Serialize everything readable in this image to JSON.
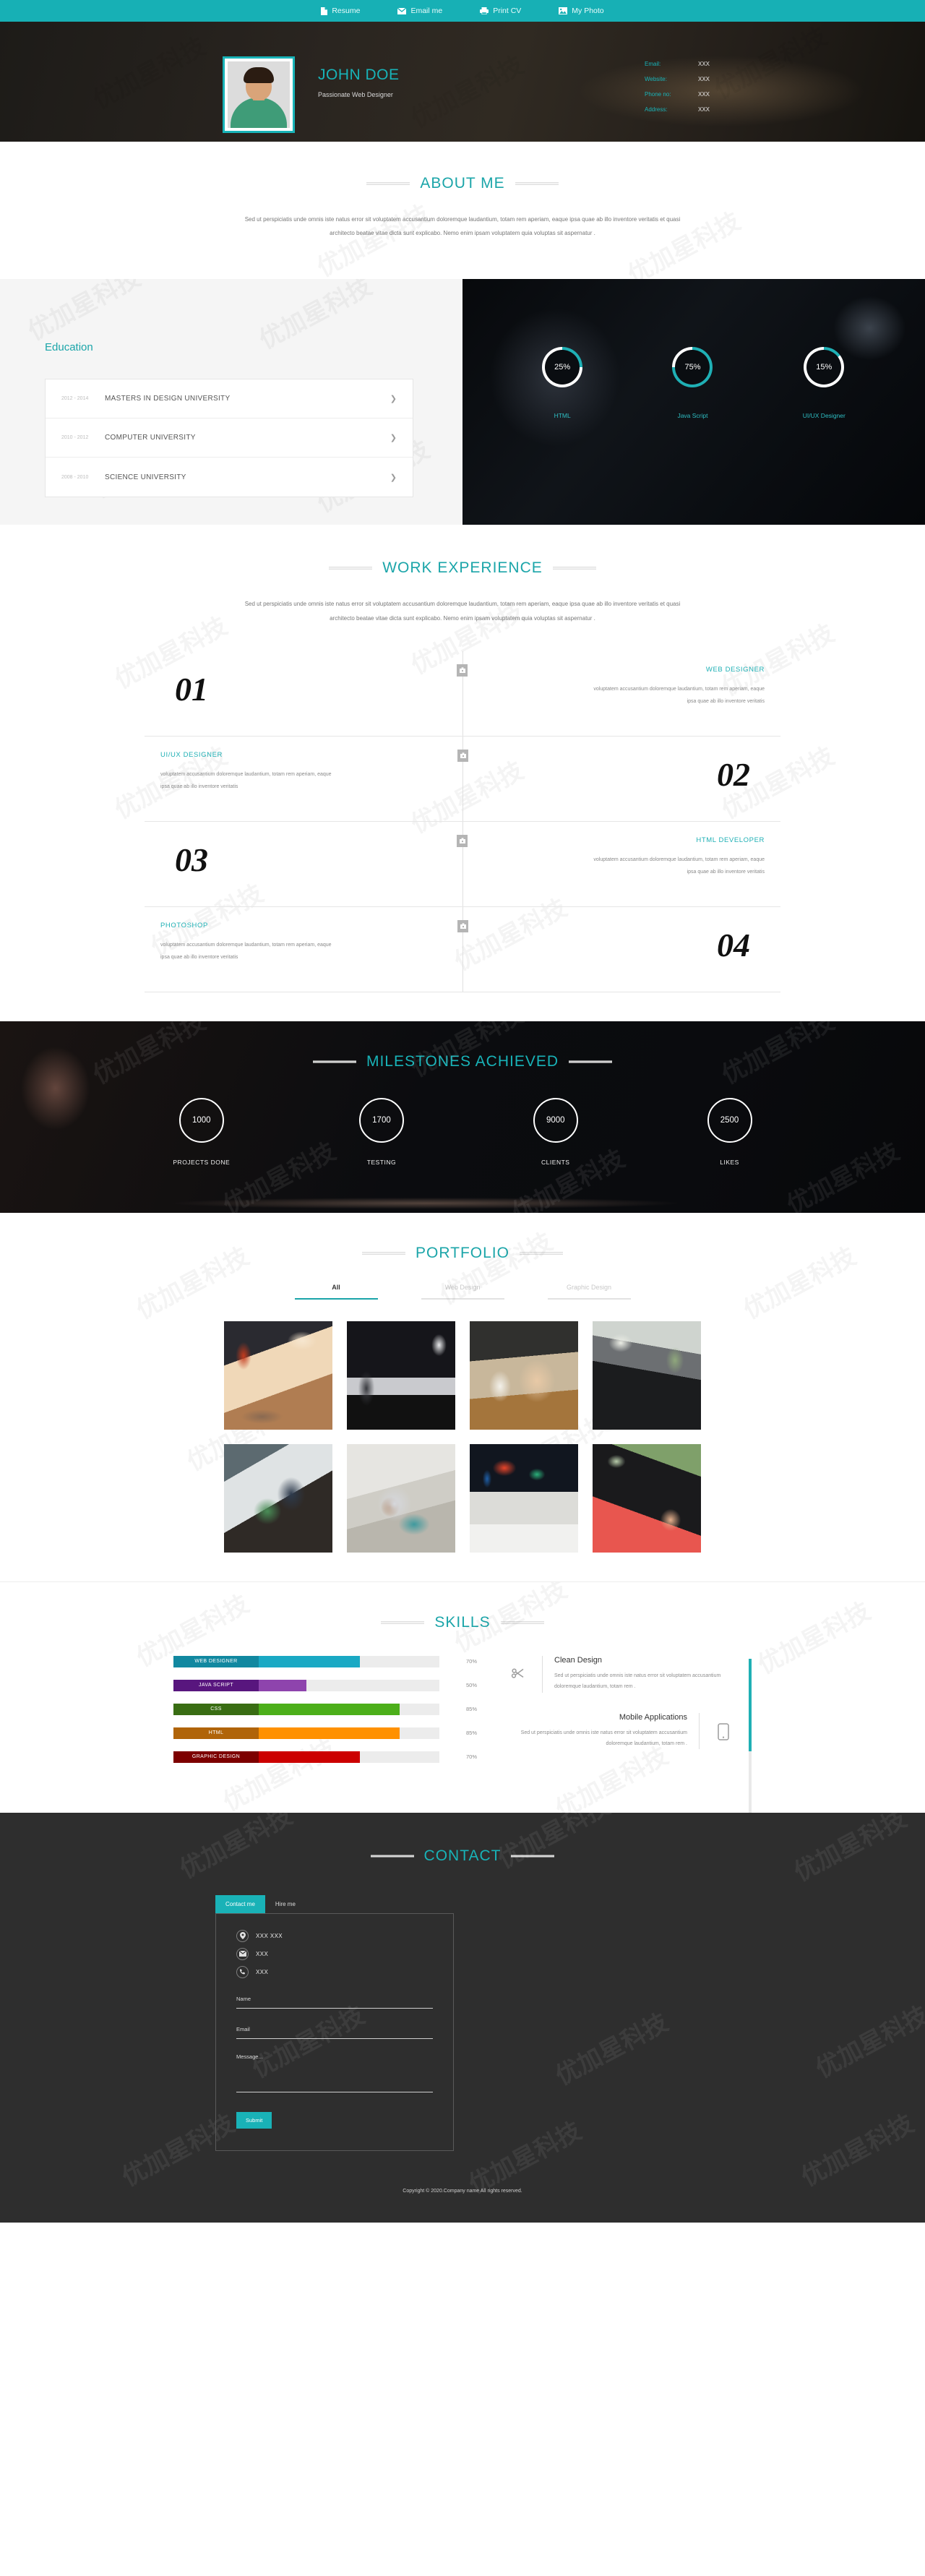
{
  "topnav": {
    "items": [
      {
        "label": "Resume",
        "icon": "file-icon"
      },
      {
        "label": "Email me",
        "icon": "envelope-icon"
      },
      {
        "label": "Print CV",
        "icon": "printer-icon"
      },
      {
        "label": "My Photo",
        "icon": "image-icon"
      }
    ]
  },
  "hero": {
    "name": "JOHN DOE",
    "subtitle": "Passionate Web Designer",
    "contact": [
      {
        "key": "Email:",
        "value": "XXX"
      },
      {
        "key": "Website:",
        "value": "XXX"
      },
      {
        "key": "Phone no:",
        "value": "XXX"
      },
      {
        "key": "Address:",
        "value": "XXX"
      }
    ]
  },
  "about": {
    "heading": "ABOUT ME",
    "text": "Sed ut perspiciatis unde omnis iste natus error sit voluptatem accusantium doloremque laudantium, totam rem aperiam, eaque ipsa quae ab illo inventore veritatis et quasi architecto beatae vitae dicta sunt explicabo. Nemo enim ipsam voluptatem quia voluptas sit aspernatur ."
  },
  "education": {
    "heading": "Education",
    "items": [
      {
        "years": "2012 - 2014",
        "title": "MASTERS IN DESIGN UNIVERSITY"
      },
      {
        "years": "2010 - 2012",
        "title": "COMPUTER UNIVERSITY"
      },
      {
        "years": "2008 - 2010",
        "title": "SCIENCE UNIVERSITY"
      }
    ]
  },
  "chart_data": [
    {
      "type": "pie",
      "title": "Skill donut gauges",
      "accent": "#1fb0b5",
      "items": [
        {
          "label": "HTML",
          "value": 25,
          "display": "25%"
        },
        {
          "label": "Java Script",
          "value": 75,
          "display": "75%"
        },
        {
          "label": "UI/UX Designer",
          "value": 15,
          "display": "15%"
        }
      ]
    },
    {
      "type": "bar",
      "title": "SKILLS",
      "orientation": "horizontal",
      "xlabel": "",
      "ylabel": "",
      "xlim": [
        0,
        100
      ],
      "grid": false,
      "categories": [
        "WEB DESIGNER",
        "JAVA SCRIPT",
        "CSS",
        "HTML",
        "GRAPHIC DESIGN"
      ],
      "values": [
        70,
        50,
        85,
        85,
        70
      ],
      "value_labels": [
        "70%",
        "50%",
        "85%",
        "85%",
        "70%"
      ],
      "colors": [
        "#1aa9c4",
        "#8e44ad",
        "#4caf1a",
        "#ff9100",
        "#cc0000"
      ],
      "label_colors": [
        "#1188a0",
        "#58167e",
        "#396d13",
        "#b06409",
        "#7d0000"
      ],
      "track_color": "#ececec"
    },
    {
      "type": "bar",
      "title": "MILESTONES ACHIEVED",
      "categories": [
        "PROJECTS DONE",
        "TESTING",
        "CLIENTS",
        "LIKES"
      ],
      "values": [
        1000,
        1700,
        9000,
        2500
      ],
      "value_labels": [
        "1000",
        "1700",
        "9000",
        "2500"
      ],
      "xlabel": "",
      "ylabel": "",
      "grid": false
    }
  ],
  "work": {
    "heading": "WORK EXPERIENCE",
    "text": "Sed ut perspiciatis unde omnis iste natus error sit voluptatem accusantium doloremque laudantium, totam rem aperiam, eaque ipsa quae ab illo inventore veritatis et quasi architecto beatae vitae dicta sunt explicabo. Nemo enim ipsam voluptatem quia voluptas sit aspernatur .",
    "items": [
      {
        "num": "01",
        "title": "WEB DESIGNER",
        "desc": "voluptatem accusantium doloremque laudantium, totam rem aperiam, eaque ipsa quae ab illo inventore veritatis",
        "side": "right"
      },
      {
        "num": "02",
        "title": "UI/UX DESIGNER",
        "desc": "voluptatem accusantium doloremque laudantium, totam rem aperiam, eaque ipsa quae ab illo inventore veritatis",
        "side": "left"
      },
      {
        "num": "03",
        "title": "HTML DEVELOPER",
        "desc": "voluptatem accusantium doloremque laudantium, totam rem aperiam, eaque ipsa quae ab illo inventore veritatis",
        "side": "right"
      },
      {
        "num": "04",
        "title": "PHOTOSHOP",
        "desc": "voluptatem accusantium doloremque laudantium, totam rem aperiam, eaque ipsa quae ab illo inventore veritatis",
        "side": "left"
      }
    ]
  },
  "milestones": {
    "heading": "MILESTONES ACHIEVED"
  },
  "portfolio": {
    "heading": "PORTFOLIO",
    "tabs": [
      {
        "label": "All",
        "active": true
      },
      {
        "label": "Web Design",
        "active": false
      },
      {
        "label": "Graphic Design",
        "active": false
      }
    ],
    "items": [
      {
        "name": "laptop-editing-photo"
      },
      {
        "name": "macbook-on-desk-photo"
      },
      {
        "name": "hands-writing-notes-photo"
      },
      {
        "name": "keyboard-books-glasses-photo"
      },
      {
        "name": "tablet-website-photo"
      },
      {
        "name": "hand-holding-phone-photo"
      },
      {
        "name": "imac-desk-photo"
      },
      {
        "name": "person-typing-laptop-photo"
      }
    ]
  },
  "skills": {
    "heading": "SKILLS",
    "cards": [
      {
        "title": "Clean Design",
        "text": "Sed ut perspiciatis unde omnis iste natus error sit voluptatem accusantium doloremque laudantium, totam rem .",
        "icon": "scissors-icon",
        "align": "ltr"
      },
      {
        "title": "Mobile Applications",
        "text": "Sed ut perspiciatis unde omnis iste natus error sit voluptatem accusantium doloremque laudantium, totam rem .",
        "icon": "mobile-icon",
        "align": "rtl"
      }
    ],
    "scrollbar_accent": "#1fb0b5"
  },
  "contact": {
    "heading": "CONTACT",
    "tabs": [
      {
        "label": "Contact me",
        "active": true
      },
      {
        "label": "Hire me",
        "active": false
      }
    ],
    "lines": [
      {
        "icon": "location-icon",
        "text": "XXX XXX"
      },
      {
        "icon": "envelope-icon",
        "text": "XXX"
      },
      {
        "icon": "phone-icon",
        "text": "XXX"
      }
    ],
    "fields": {
      "name_placeholder": "Name",
      "name_value": "",
      "email_placeholder": "Email",
      "email_value": "",
      "message_placeholder": "Message...",
      "message_value": ""
    },
    "submit_label": "Submit"
  },
  "footer": {
    "copyright": "Copyright © 2020.Company name All rights reserved."
  },
  "theme": {
    "accent": "#19b2b7",
    "accent_dark": "#1ba5a9",
    "dark_bg": "#2e2e2e"
  }
}
